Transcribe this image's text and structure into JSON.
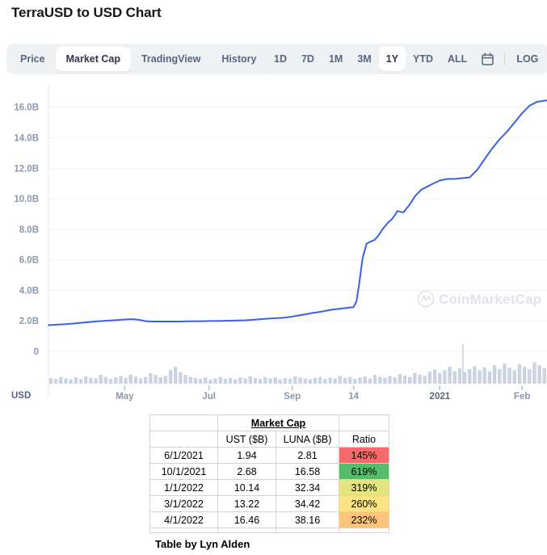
{
  "header": {
    "title": "TerraUSD to USD Chart"
  },
  "tabs": [
    {
      "label": "Price",
      "active": false
    },
    {
      "label": "Market Cap",
      "active": true
    },
    {
      "label": "TradingView",
      "active": false
    },
    {
      "label": "History",
      "active": false
    }
  ],
  "ranges": [
    {
      "label": "1D",
      "active": false
    },
    {
      "label": "7D",
      "active": false
    },
    {
      "label": "1M",
      "active": false
    },
    {
      "label": "3M",
      "active": false
    },
    {
      "label": "1Y",
      "active": true
    },
    {
      "label": "YTD",
      "active": false
    },
    {
      "label": "ALL",
      "active": false
    }
  ],
  "calendar_icon": "calendar-icon",
  "log_label": "LOG",
  "watermark": "CoinMarketCap",
  "axis_unit": "USD",
  "colors": {
    "line": "#3761e8",
    "grid": "#eff2f5",
    "volume": "#ccd3e0",
    "tab_bg": "#eff2f5",
    "text_muted": "#58667e"
  },
  "chart_data": {
    "type": "line",
    "title": "TerraUSD to USD Chart",
    "xlabel": "",
    "ylabel": "USD",
    "ylim": [
      0,
      17.2
    ],
    "unit": "B",
    "grid": true,
    "legend": "none",
    "ytick_labels": [
      "16.0B",
      "14.0B",
      "12.0B",
      "10.0B",
      "8.0B",
      "6.0B",
      "4.0B",
      "2.0B",
      "0"
    ],
    "ytick_values": [
      16,
      14,
      12,
      10,
      8,
      6,
      4,
      2,
      0
    ],
    "xtick_labels": [
      "May",
      "Jul",
      "Sep",
      "14",
      "2021",
      "Feb"
    ],
    "xtick_positions": [
      0.153,
      0.322,
      0.489,
      0.612,
      0.785,
      0.95
    ],
    "series": [
      {
        "name": "Market Cap",
        "color": "#3761e8",
        "x": [
          0.0,
          0.02,
          0.04,
          0.06,
          0.08,
          0.1,
          0.12,
          0.14,
          0.155,
          0.168,
          0.18,
          0.195,
          0.21,
          0.225,
          0.24,
          0.26,
          0.28,
          0.3,
          0.322,
          0.345,
          0.37,
          0.395,
          0.42,
          0.445,
          0.47,
          0.489,
          0.51,
          0.53,
          0.55,
          0.565,
          0.58,
          0.595,
          0.605,
          0.612,
          0.618,
          0.624,
          0.63,
          0.638,
          0.646,
          0.654,
          0.662,
          0.67,
          0.68,
          0.69,
          0.7,
          0.712,
          0.724,
          0.736,
          0.748,
          0.76,
          0.772,
          0.785,
          0.8,
          0.815,
          0.83,
          0.845,
          0.86,
          0.875,
          0.89,
          0.905,
          0.92,
          0.935,
          0.95,
          0.965,
          0.98,
          1.0
        ],
        "y": [
          1.72,
          1.76,
          1.8,
          1.86,
          1.92,
          1.98,
          2.02,
          2.06,
          2.1,
          2.11,
          2.08,
          1.98,
          1.96,
          1.96,
          1.96,
          1.96,
          1.97,
          1.98,
          1.99,
          2.0,
          2.02,
          2.04,
          2.1,
          2.16,
          2.2,
          2.28,
          2.4,
          2.52,
          2.62,
          2.72,
          2.78,
          2.84,
          2.88,
          2.9,
          3.3,
          4.6,
          6.1,
          7.05,
          7.2,
          7.3,
          7.6,
          8.0,
          8.4,
          8.7,
          9.2,
          9.1,
          9.6,
          10.2,
          10.6,
          10.8,
          11.0,
          11.2,
          11.3,
          11.3,
          11.35,
          11.4,
          11.9,
          12.6,
          13.3,
          13.9,
          14.4,
          15.0,
          15.6,
          16.1,
          16.35,
          16.45
        ]
      }
    ],
    "volume_bars": {
      "name": "Volume",
      "color": "#ccd3e0",
      "spike_position": 0.83,
      "spike_height": 1.0,
      "baseline_heights": [
        0.12,
        0.1,
        0.14,
        0.11,
        0.09,
        0.13,
        0.1,
        0.15,
        0.12,
        0.11,
        0.18,
        0.14,
        0.1,
        0.13,
        0.16,
        0.12,
        0.19,
        0.15,
        0.11,
        0.14,
        0.22,
        0.18,
        0.13,
        0.16,
        0.28,
        0.35,
        0.24,
        0.18,
        0.14,
        0.12,
        0.1,
        0.13,
        0.09,
        0.11,
        0.14,
        0.1,
        0.12,
        0.09,
        0.13,
        0.11,
        0.15,
        0.12,
        0.1,
        0.14,
        0.11,
        0.13,
        0.09,
        0.12,
        0.1,
        0.15,
        0.13,
        0.11,
        0.09,
        0.12,
        0.14,
        0.1,
        0.13,
        0.11,
        0.16,
        0.12,
        0.14,
        0.1,
        0.13,
        0.15,
        0.11,
        0.18,
        0.14,
        0.12,
        0.16,
        0.13,
        0.2,
        0.17,
        0.14,
        0.22,
        0.19,
        0.16,
        0.25,
        0.3,
        0.22,
        0.28,
        0.35,
        0.26,
        0.32,
        0.24,
        0.3,
        0.36,
        0.28,
        0.34,
        0.26,
        0.38,
        0.3,
        0.42,
        0.33,
        0.28,
        0.4,
        0.35,
        0.3,
        0.44,
        0.38,
        0.32
      ]
    }
  },
  "table": {
    "group_header": "Market Cap",
    "columns": [
      "",
      "UST ($B)",
      "LUNA ($B)",
      "Ratio"
    ],
    "rows": [
      {
        "date": "6/1/2021",
        "ust": "1.94",
        "luna": "2.81",
        "ratio": "145%",
        "ratio_color": "#F8696B"
      },
      {
        "date": "10/1/2021",
        "ust": "2.68",
        "luna": "16.58",
        "ratio": "619%",
        "ratio_color": "#57BB6C"
      },
      {
        "date": "1/1/2022",
        "ust": "10.14",
        "luna": "32.34",
        "ratio": "319%",
        "ratio_color": "#E6E383"
      },
      {
        "date": "3/1/2022",
        "ust": "13.22",
        "luna": "34.42",
        "ratio": "260%",
        "ratio_color": "#FCE383"
      },
      {
        "date": "4/1/2022",
        "ust": "16.46",
        "luna": "38.16",
        "ratio": "232%",
        "ratio_color": "#FCC47D"
      }
    ],
    "credit": "Table by Lyn Alden"
  }
}
